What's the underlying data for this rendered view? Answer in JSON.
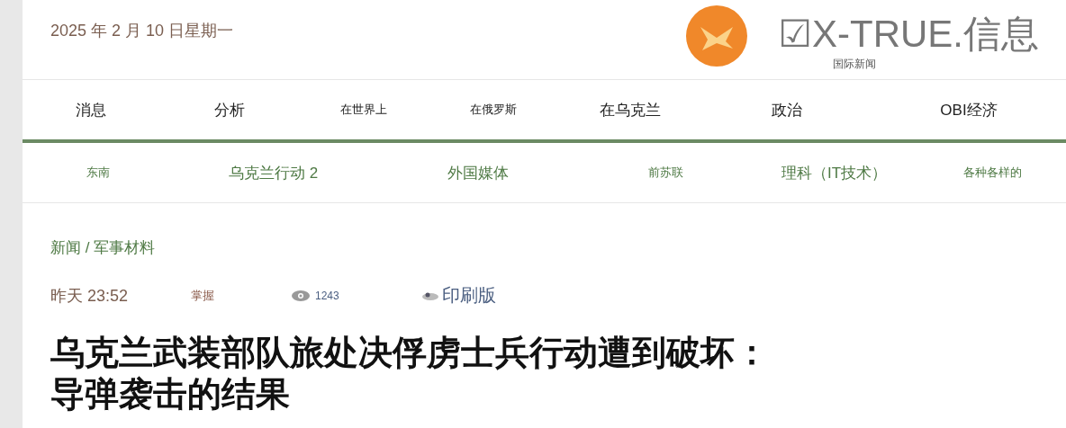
{
  "header": {
    "date": "2025 年 2 月 10 日星期一",
    "logo": {
      "title": "☑X-TRUE.信息",
      "subtitle": "国际新闻"
    }
  },
  "main_nav": [
    {
      "label": "消息",
      "kind": "regular"
    },
    {
      "label": "分析",
      "kind": "regular"
    },
    {
      "label": "在世界上",
      "kind": "compact"
    },
    {
      "label": "在俄罗斯",
      "kind": "compact"
    },
    {
      "label": "在乌克兰",
      "kind": "regular"
    },
    {
      "label": "政治",
      "kind": "regular"
    },
    {
      "label": "OBI经济",
      "kind": "regular"
    }
  ],
  "sub_nav": [
    {
      "label": "东南",
      "kind": "compact"
    },
    {
      "label": "乌克兰行动 2",
      "kind": "regular"
    },
    {
      "label": "外国媒体",
      "kind": "regular"
    },
    {
      "label": "前苏联",
      "kind": "compact"
    },
    {
      "label": "理科（IT技术）",
      "kind": "regular"
    },
    {
      "label": "各种各样的",
      "kind": "compact"
    }
  ],
  "article": {
    "breadcrumb": "新闻 / 军事材料",
    "time": "昨天 23:52",
    "author": "掌握",
    "views": "1243",
    "print": "印刷版",
    "title_lines": [
      "乌克兰武装部队旅处决俘虏士兵行动遭到破坏：",
      "导弹袭击的结果"
    ]
  }
}
